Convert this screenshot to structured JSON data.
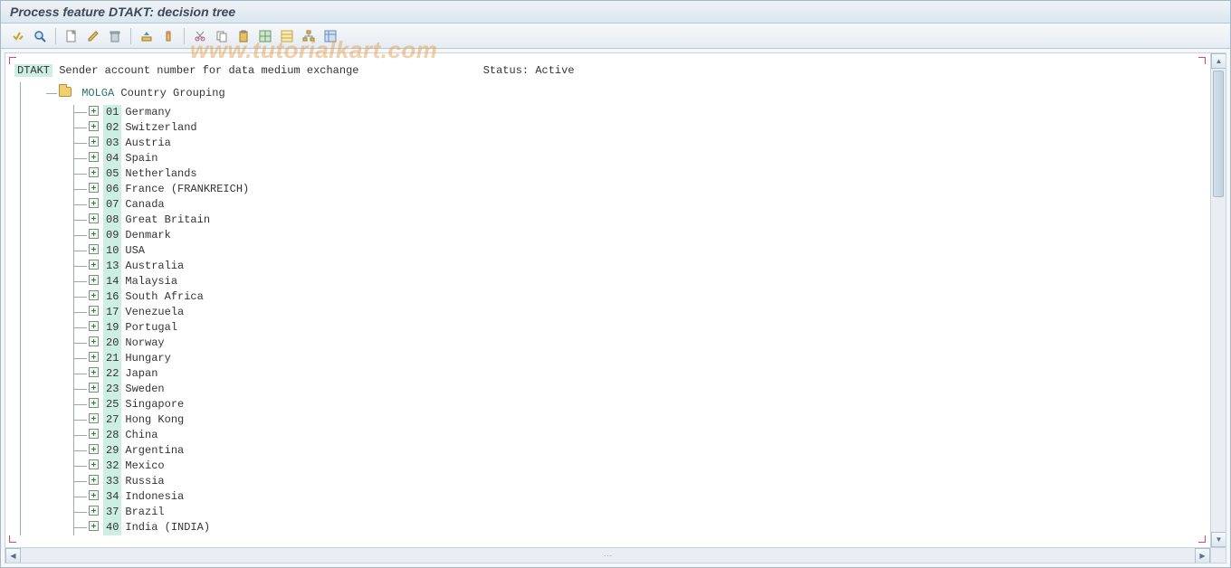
{
  "title": "Process feature DTAKT: decision tree",
  "watermark": "www.tutorialkart.com",
  "toolbar": {
    "check": "check",
    "find": "find",
    "create": "create",
    "edit": "edit",
    "delete": "delete",
    "collapse": "collapse",
    "expand": "expand",
    "cut": "cut",
    "copy": "copy",
    "paste": "paste",
    "view1": "view1",
    "view2": "view2",
    "view3": "view3",
    "view4": "view4"
  },
  "root": {
    "code": "DTAKT",
    "desc": "Sender account number for data medium exchange",
    "status_label": "Status:",
    "status_value": "Active"
  },
  "molga": {
    "code": "MOLGA",
    "label": "Country Grouping"
  },
  "nodes": [
    {
      "code": "01",
      "label": "Germany"
    },
    {
      "code": "02",
      "label": "Switzerland"
    },
    {
      "code": "03",
      "label": "Austria"
    },
    {
      "code": "04",
      "label": "Spain"
    },
    {
      "code": "05",
      "label": "Netherlands"
    },
    {
      "code": "06",
      "label": "France (FRANKREICH)"
    },
    {
      "code": "07",
      "label": "Canada"
    },
    {
      "code": "08",
      "label": "Great Britain"
    },
    {
      "code": "09",
      "label": "Denmark"
    },
    {
      "code": "10",
      "label": "USA"
    },
    {
      "code": "13",
      "label": "Australia"
    },
    {
      "code": "14",
      "label": "Malaysia"
    },
    {
      "code": "16",
      "label": "South Africa"
    },
    {
      "code": "17",
      "label": "Venezuela"
    },
    {
      "code": "19",
      "label": "Portugal"
    },
    {
      "code": "20",
      "label": "Norway"
    },
    {
      "code": "21",
      "label": "Hungary"
    },
    {
      "code": "22",
      "label": "Japan"
    },
    {
      "code": "23",
      "label": "Sweden"
    },
    {
      "code": "25",
      "label": "Singapore"
    },
    {
      "code": "27",
      "label": "Hong Kong"
    },
    {
      "code": "28",
      "label": "China"
    },
    {
      "code": "29",
      "label": "Argentina"
    },
    {
      "code": "32",
      "label": "Mexico"
    },
    {
      "code": "33",
      "label": "Russia"
    },
    {
      "code": "34",
      "label": "Indonesia"
    },
    {
      "code": "37",
      "label": "Brazil"
    },
    {
      "code": "40",
      "label": "India (INDIA)"
    }
  ]
}
